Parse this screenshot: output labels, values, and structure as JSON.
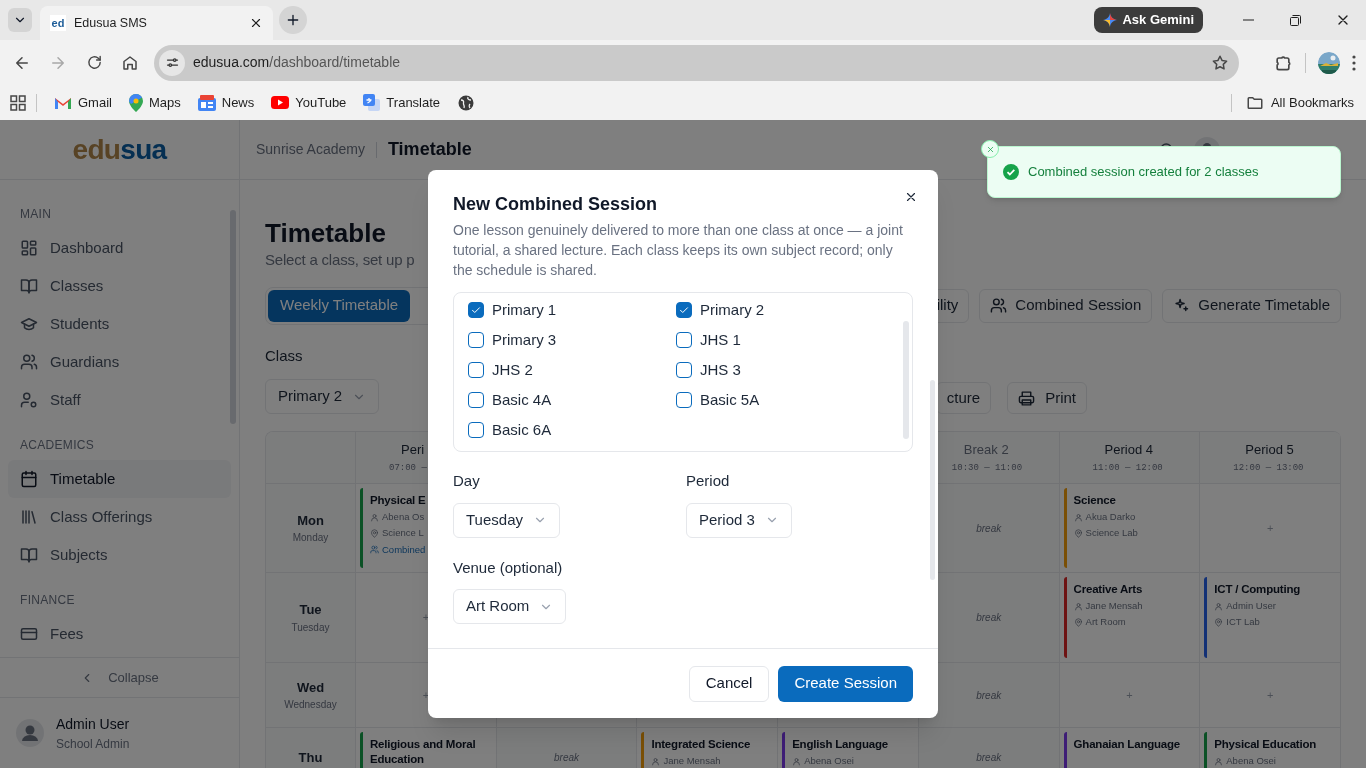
{
  "browser": {
    "tab": {
      "icon_text": "ed",
      "title": "Edusua SMS"
    },
    "ask_gemini": "Ask Gemini",
    "url_host": "edusua.com",
    "url_path": "/dashboard/timetable",
    "bookmarks": [
      "Gmail",
      "Maps",
      "News",
      "YouTube",
      "Translate"
    ],
    "all_bookmarks": "All Bookmarks"
  },
  "sidebar": {
    "logo_start": "edu",
    "logo_end": "sua",
    "sections": [
      {
        "heading": "MAIN",
        "items": [
          {
            "label": "Dashboard",
            "selected": false
          },
          {
            "label": "Classes",
            "selected": false
          },
          {
            "label": "Students",
            "selected": false
          },
          {
            "label": "Guardians",
            "selected": false
          },
          {
            "label": "Staff",
            "selected": false
          }
        ]
      },
      {
        "heading": "ACADEMICS",
        "items": [
          {
            "label": "Timetable",
            "selected": true
          },
          {
            "label": "Class Offerings",
            "selected": false
          },
          {
            "label": "Subjects",
            "selected": false
          }
        ]
      },
      {
        "heading": "FINANCE",
        "items": [
          {
            "label": "Fees",
            "selected": false
          }
        ]
      }
    ],
    "collapse": "Collapse",
    "user": {
      "name": "Admin User",
      "role": "School Admin"
    }
  },
  "header": {
    "school": "Sunrise Academy",
    "page": "Timetable"
  },
  "page": {
    "title": "Timetable",
    "subtitle": "Select a class, set up p",
    "tabs": [
      {
        "label": "Weekly Timetable",
        "selected": true
      }
    ],
    "actions": [
      "ility",
      "Combined Session",
      "Generate Timetable"
    ],
    "class_label": "Class",
    "class_value": "Primary 2",
    "tools": [
      "cture",
      "Print"
    ]
  },
  "timetable": {
    "columns": [
      {
        "kind": "period",
        "label": "Peri",
        "time": "07:00 —"
      },
      {
        "kind": "covered"
      },
      {
        "kind": "covered"
      },
      {
        "kind": "covered"
      },
      {
        "kind": "break",
        "label": "Break 2",
        "time": "10:30 — 11:00"
      },
      {
        "kind": "period",
        "label": "Period 4",
        "time": "11:00 — 12:00"
      },
      {
        "kind": "period",
        "label": "Period 5",
        "time": "12:00 — 13:00"
      }
    ],
    "rows": [
      {
        "short": "Mon",
        "long": "Monday",
        "cells": [
          {
            "kind": "lesson",
            "subject": "Physical E",
            "teacher": "Abena Os",
            "venue": "Science L",
            "note": "Combined",
            "color": "#0b5125"
          },
          {
            "kind": "covered"
          },
          {
            "kind": "covered"
          },
          {
            "kind": "covered"
          },
          {
            "kind": "break",
            "label": "break"
          },
          {
            "kind": "lesson",
            "subject": "Science",
            "teacher": "Akua Darko",
            "venue": "Science Lab",
            "color": "#7a4f05"
          },
          {
            "kind": "empty",
            "label": "+"
          }
        ]
      },
      {
        "short": "Tue",
        "long": "Tuesday",
        "cells": [
          {
            "kind": "empty",
            "label": "+"
          },
          {
            "kind": "covered"
          },
          {
            "kind": "covered"
          },
          {
            "kind": "covered"
          },
          {
            "kind": "break",
            "label": "break"
          },
          {
            "kind": "lesson",
            "subject": "Creative Arts",
            "teacher": "Jane Mensah",
            "venue": "Art Room",
            "color": "#6e1313"
          },
          {
            "kind": "lesson",
            "subject": "ICT / Computing",
            "teacher": "Admin User",
            "venue": "ICT Lab",
            "color": "#133176"
          }
        ]
      },
      {
        "short": "Wed",
        "long": "Wednesday",
        "cells": [
          {
            "kind": "empty",
            "label": "+"
          },
          {
            "kind": "blank"
          },
          {
            "kind": "blank"
          },
          {
            "kind": "blank"
          },
          {
            "kind": "break",
            "label": "break"
          },
          {
            "kind": "empty",
            "label": "+"
          },
          {
            "kind": "empty",
            "label": "+"
          }
        ]
      },
      {
        "short": "Thu",
        "cells": [
          {
            "kind": "lesson",
            "subject": "Religious and Moral Education",
            "color": "#0b5125"
          },
          {
            "kind": "break",
            "label": "break"
          },
          {
            "kind": "lesson",
            "subject": "Integrated Science",
            "teacher": "Jane Mensah",
            "color": "#7a4f05"
          },
          {
            "kind": "lesson",
            "subject": "English Language",
            "teacher": "Abena Osei",
            "color": "#3e1d76"
          },
          {
            "kind": "break",
            "label": "break"
          },
          {
            "kind": "lesson",
            "subject": "Ghanaian Language",
            "color": "#3e1d76"
          },
          {
            "kind": "lesson",
            "subject": "Physical Education",
            "teacher": "Abena Osei",
            "color": "#0b5125"
          }
        ]
      }
    ]
  },
  "toast": {
    "message": "Combined session created for 2 classes"
  },
  "modal": {
    "title": "New Combined Session",
    "description": "One lesson genuinely delivered to more than one class at once — a joint tutorial, a shared lecture. Each class keeps its own subject record; only the schedule is shared.",
    "classes": [
      {
        "label": "Primary 1",
        "checked": true
      },
      {
        "label": "Primary 2",
        "checked": true
      },
      {
        "label": "Primary 3",
        "checked": false
      },
      {
        "label": "JHS 1",
        "checked": false
      },
      {
        "label": "JHS 2",
        "checked": false
      },
      {
        "label": "JHS 3",
        "checked": false
      },
      {
        "label": "Basic 4A",
        "checked": false
      },
      {
        "label": "Basic 5A",
        "checked": false
      },
      {
        "label": "Basic 6A",
        "checked": false
      }
    ],
    "day_label": "Day",
    "day": "Tuesday",
    "period_label": "Period",
    "period": "Period 3",
    "venue_label": "Venue (optional)",
    "venue": "Art Room",
    "cancel": "Cancel",
    "submit": "Create Session"
  }
}
